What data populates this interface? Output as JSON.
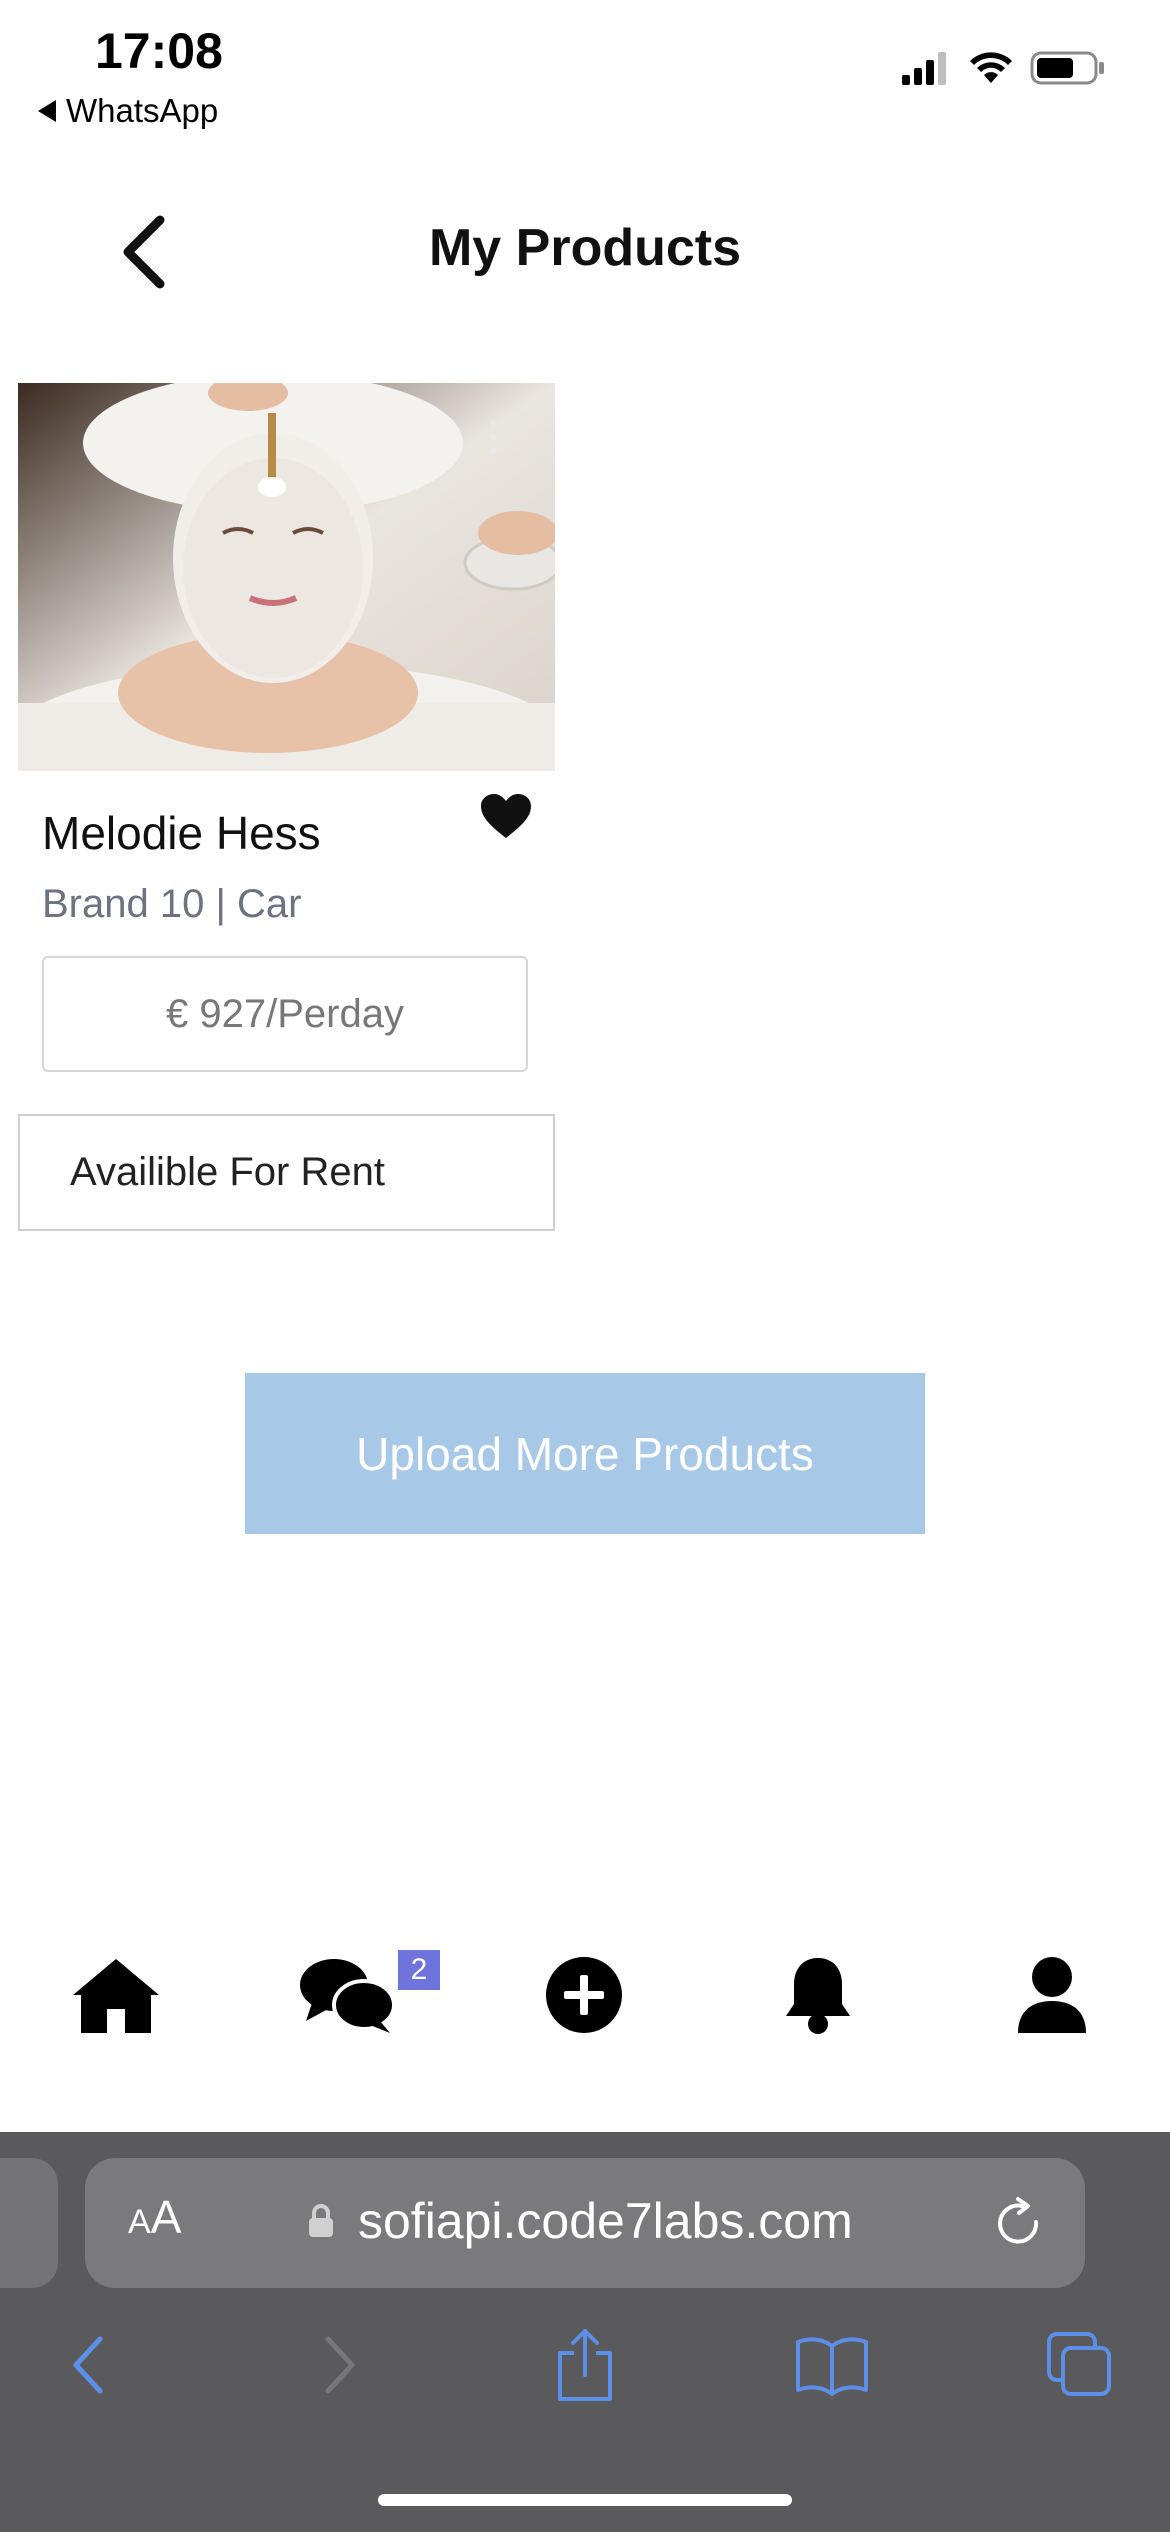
{
  "status_bar": {
    "time": "17:08",
    "back_app": "WhatsApp"
  },
  "header": {
    "title": "My Products"
  },
  "product": {
    "name": "Melodie Hess",
    "meta": "Brand 10 | Car",
    "price": "€ 927/Perday",
    "availability": "Availible For Rent",
    "favorited": true
  },
  "upload_button": {
    "label": "Upload More Products"
  },
  "bottom_nav": {
    "items": [
      "home-icon",
      "chat-icon",
      "add-icon",
      "bell-icon",
      "user-icon"
    ],
    "chat_badge": "2"
  },
  "safari": {
    "aa_label_small": "A",
    "aa_label_large": "A",
    "url": "sofiapi.code7labs.com"
  },
  "colors": {
    "upload_button_bg": "#a7c8e6",
    "badge_bg": "#6f74dd",
    "safari_bar_bg": "#5a5a5c",
    "safari_accent": "#5b8fe8"
  }
}
